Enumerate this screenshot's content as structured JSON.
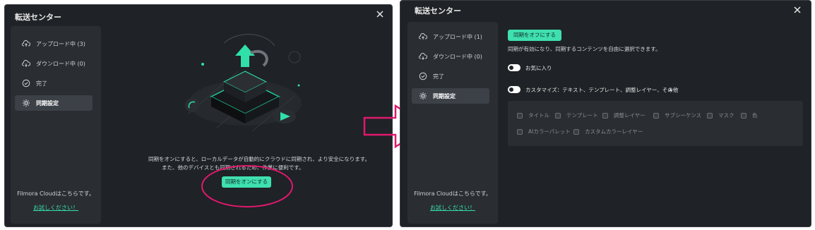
{
  "left": {
    "title": "転送センター",
    "nav": [
      "アップロード中 (3)",
      "ダウンロード中 (0)",
      "完了",
      "同期設定"
    ],
    "footer_text": "Filmora Cloudはこちらです。",
    "footer_link": "お試しください！",
    "desc_line1": "同期をオンにすると、ローカルデータが自動的にクラウドに同期され、より安全になります。",
    "desc_line2": "また、他のデバイスとも同期されるため、作業に便利です。",
    "sync_on_button": "同期をオンにする"
  },
  "right": {
    "title": "転送センター",
    "nav": [
      "アップロード中 (1)",
      "ダウンロード中 (0)",
      "完了",
      "同期設定"
    ],
    "footer_text": "Filmora Cloudはこちらです。",
    "footer_link": "お試しください！",
    "sync_off_button": "同期をオフにする",
    "sync_desc": "同期が有効になり、同期するコンテンツを自由に選択できます。",
    "favorites_label": "お気に入り",
    "customize_label": "カスタマイズ：テキスト、テンプレート、調整レイヤー、その他",
    "options_row1": [
      "タイトル",
      "テンプレート",
      "調整レイヤー",
      "サブシーケンス",
      "マスク",
      "色"
    ],
    "options_row2": [
      "AIカラーパレット",
      "カスタムカラーレイヤー"
    ]
  },
  "colors": {
    "accent": "#3fe0b0",
    "highlight": "#e0186e",
    "window_bg": "#1f2226",
    "sidebar_bg": "#2a2d32"
  },
  "icons": [
    "close-icon",
    "cloud-upload-icon",
    "cloud-download-icon",
    "check-circle-icon",
    "gear-icon",
    "chevron-up-icon",
    "arrow-right-icon"
  ]
}
